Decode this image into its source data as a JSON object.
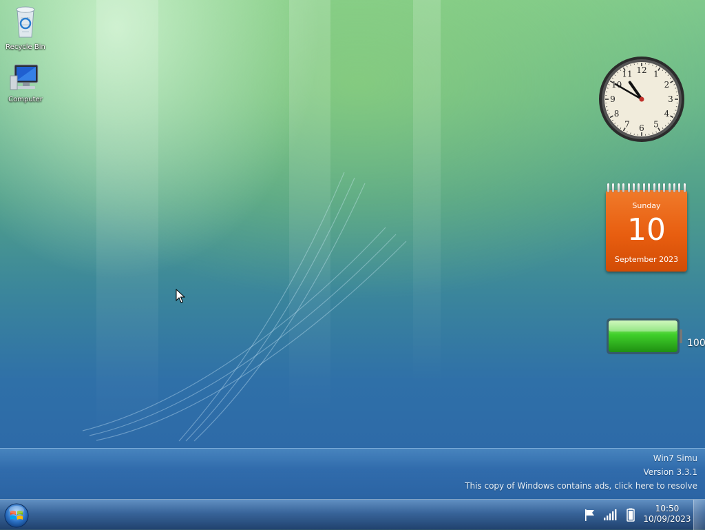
{
  "desktop": {
    "icons": [
      {
        "label": "Recycle Bin",
        "icon": "recycle-bin-icon"
      },
      {
        "label": "Computer",
        "icon": "computer-icon"
      }
    ]
  },
  "gadgets": {
    "clock": {
      "time": "10:50",
      "numerals": [
        "12",
        "1",
        "2",
        "3",
        "4",
        "5",
        "6",
        "7",
        "8",
        "9",
        "10",
        "11"
      ]
    },
    "calendar": {
      "day_name": "Sunday",
      "day": "10",
      "month_year": "September 2023",
      "color": "#e8600f"
    },
    "battery": {
      "percent_label": "100",
      "level": 1.0,
      "color": "#3fcf2a"
    }
  },
  "watermark": {
    "line1": "Win7 Simu",
    "line2": "Version 3.3.1",
    "line3": "This copy of Windows contains ads, click here to resolve"
  },
  "taskbar": {
    "start_icon": "windows-orb-icon",
    "tray_icons": [
      "action-center-flag-icon",
      "network-signal-icon",
      "battery-icon"
    ],
    "clock_time": "10:50",
    "clock_date": "10/09/2023"
  }
}
